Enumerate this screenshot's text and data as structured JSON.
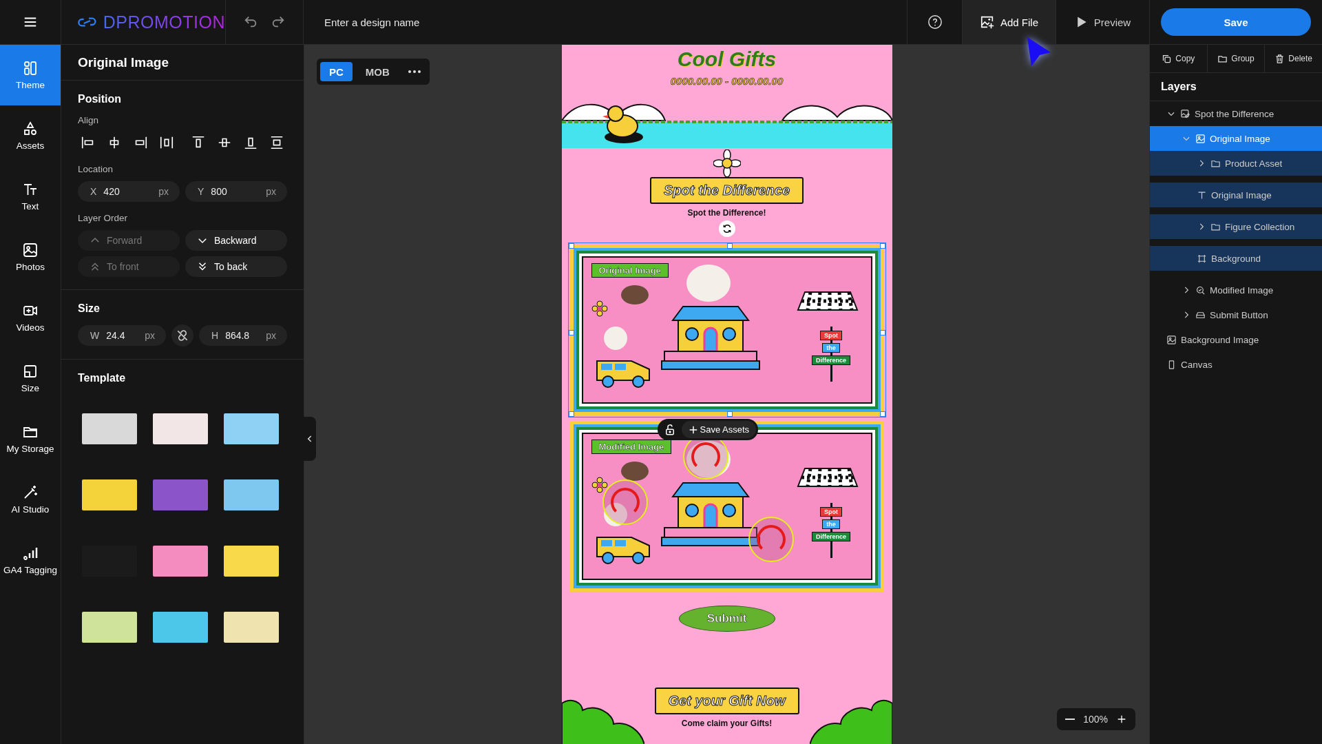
{
  "app": {
    "logo": "DPROMOTION",
    "design_name": {
      "placeholder": "Enter a design name"
    },
    "actions": [
      {
        "kind": "add",
        "label": "Add File"
      },
      {
        "kind": "preview",
        "label": "Preview"
      }
    ],
    "save": "Save"
  },
  "nav": [
    {
      "kind": "theme",
      "label": "Theme",
      "selected": true
    },
    {
      "kind": "assets",
      "label": "Assets",
      "selected": false
    },
    {
      "kind": "text",
      "label": "Text",
      "selected": false
    },
    {
      "kind": "photos",
      "label": "Photos",
      "selected": false
    },
    {
      "kind": "videos",
      "label": "Videos",
      "selected": false
    },
    {
      "kind": "size",
      "label": "Size",
      "selected": false
    },
    {
      "kind": "storage",
      "label": "My Storage",
      "selected": false
    },
    {
      "kind": "ai",
      "label": "AI Studio",
      "selected": false
    },
    {
      "kind": "ga4",
      "label": "GA4 Tagging",
      "selected": false
    }
  ],
  "panel": {
    "title": "Original Image",
    "position": {
      "title": "Position",
      "align_label": "Align",
      "location_label": "Location",
      "fields": [
        {
          "label": "X",
          "value": "420",
          "unit": "px"
        },
        {
          "label": "Y",
          "value": "800",
          "unit": "px"
        }
      ],
      "order_label": "Layer Order",
      "order_buttons": [
        {
          "kind": "up",
          "label": "Forward",
          "disabled": true
        },
        {
          "kind": "down",
          "label": "Backward",
          "disabled": false
        },
        {
          "kind": "top",
          "label": "To front",
          "disabled": true
        },
        {
          "kind": "bottom",
          "label": "To back",
          "disabled": false
        }
      ]
    },
    "size": {
      "title": "Size",
      "w": {
        "label": "W",
        "value": "24.4",
        "unit": "px"
      },
      "h": {
        "label": "H",
        "value": "864.8",
        "unit": "px"
      }
    },
    "template_title": "Template"
  },
  "view_toggle": [
    {
      "label": "PC",
      "selected": true
    },
    {
      "label": "MOB",
      "selected": false
    }
  ],
  "design": {
    "title": "Cool Gifts",
    "dates": "0000.00.00 - 0000.00.00",
    "heading": "Spot the Difference",
    "subheading": "Spot the Difference!",
    "panels": [
      {
        "kind": "original",
        "label": "Original Image",
        "selected": true,
        "signs": [
          "Spot",
          "the",
          "Difference"
        ]
      },
      {
        "kind": "modified",
        "label": "Modified Image",
        "selected": false,
        "signs": [
          "Spot",
          "the",
          "Difference"
        ]
      }
    ],
    "save_assets": "Save Assets",
    "submit": "Submit",
    "cta_heading": "Get your Gift Now",
    "cta_text": "Come claim your Gifts!"
  },
  "zoom": {
    "value": "100%"
  },
  "toolbar": [
    {
      "kind": "copy",
      "label": "Copy"
    },
    {
      "kind": "group",
      "label": "Group"
    },
    {
      "kind": "delete",
      "label": "Delete"
    }
  ],
  "layers": {
    "title": "Layers",
    "items": [
      {
        "kind": "group",
        "label": "Spot the Difference",
        "selected": false,
        "expanded": true,
        "children": [
          {
            "kind": "image",
            "label": "Original Image",
            "selected": true,
            "expanded": true,
            "children": [
              {
                "kind": "folder",
                "label": "Product Asset",
                "selected": false,
                "expanded": false
              },
              {
                "kind": "text",
                "label": "Original Image",
                "selected": false
              },
              {
                "kind": "folder",
                "label": "Figure Collection",
                "selected": false,
                "expanded": false
              },
              {
                "kind": "frame",
                "label": "Background",
                "selected": false
              }
            ]
          },
          {
            "kind": "modified",
            "label": "Modified Image",
            "selected": false,
            "expanded": false
          },
          {
            "kind": "button",
            "label": "Submit Button",
            "selected": false,
            "expanded": false
          }
        ]
      },
      {
        "kind": "image",
        "label": "Background Image",
        "selected": false
      },
      {
        "kind": "canvas",
        "label": "Canvas",
        "selected": false
      }
    ]
  }
}
